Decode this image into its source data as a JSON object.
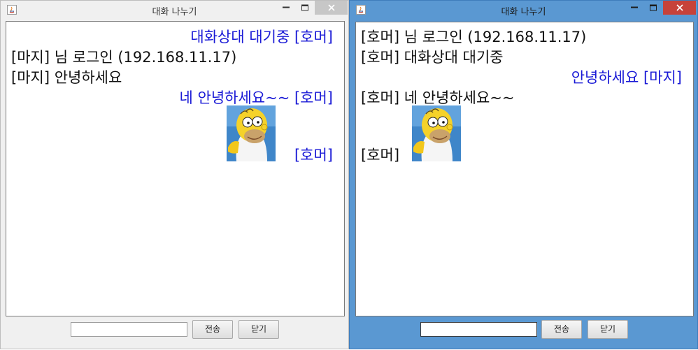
{
  "left_window": {
    "title": "대화 나누기",
    "messages": [
      {
        "text": "대화상대 대기중 [호머]",
        "align": "right",
        "color": "#1a1ad6"
      },
      {
        "text": "[마지] 님 로그인 (192.168.11.17)",
        "align": "left",
        "color": "#111111"
      },
      {
        "text": "[마지] 안녕하세요",
        "align": "left",
        "color": "#111111"
      },
      {
        "text": "네 안녕하세요~~ [호머]",
        "align": "right",
        "color": "#1a1ad6"
      },
      {
        "text": "[호머]",
        "align": "right",
        "color": "#1a1ad6",
        "attachment": "homer-avatar"
      }
    ],
    "send_label": "전송",
    "close_label": "닫기",
    "input_value": ""
  },
  "right_window": {
    "title": "대화 나누기",
    "messages": [
      {
        "text": "[호머] 님 로그인 (192.168.11.17)",
        "align": "left",
        "color": "#111111"
      },
      {
        "text": "[호머] 대화상대 대기중",
        "align": "left",
        "color": "#111111"
      },
      {
        "text": "안녕하세요 [마지]",
        "align": "right",
        "color": "#1a1ad6"
      },
      {
        "text": "[호머] 네 안녕하세요~~",
        "align": "left",
        "color": "#111111"
      },
      {
        "text": "[호머]",
        "align": "left",
        "color": "#111111",
        "attachment": "homer-avatar"
      }
    ],
    "send_label": "전송",
    "close_label": "닫기",
    "input_value": ""
  },
  "colors": {
    "own_message": "#1a1ad6",
    "other_message": "#111111",
    "active_titlebar": "#5a98d2",
    "inactive_titlebar": "#f0f0f0",
    "close_button_active": "#c7423a"
  }
}
